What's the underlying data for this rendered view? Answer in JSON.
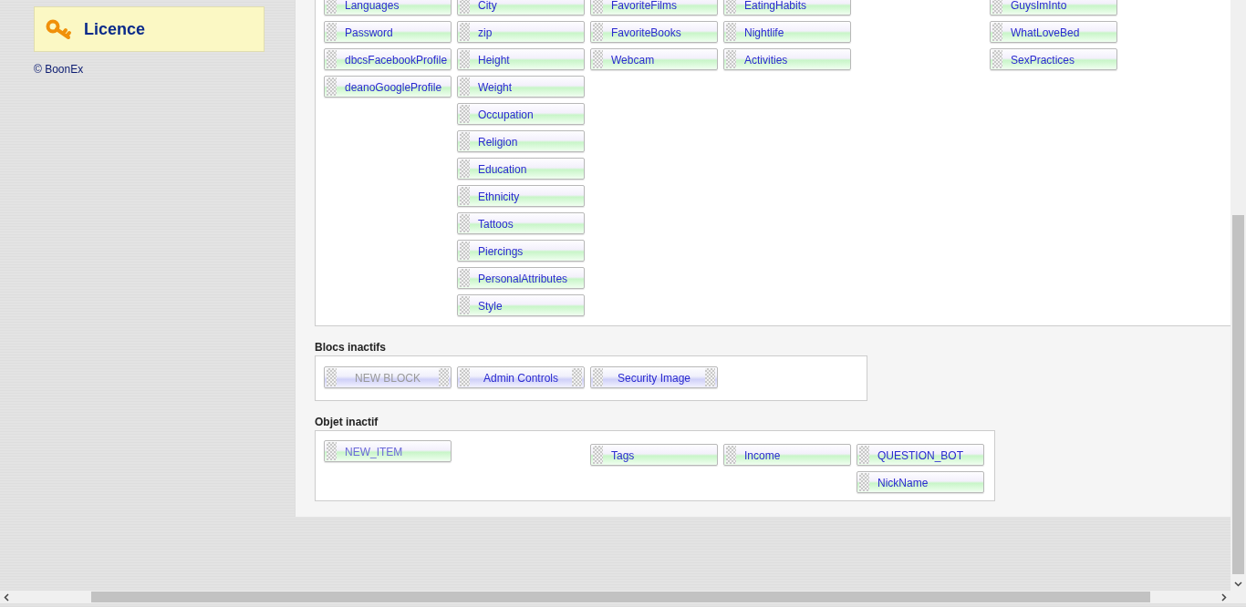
{
  "sidebar": {
    "licence": {
      "label": "Licence"
    },
    "copyright": "© BoonEx"
  },
  "active_fields": {
    "columns": [
      {
        "items": [
          {
            "label": "Languages"
          },
          {
            "label": "Password"
          },
          {
            "label": "dbcsFacebookProfile"
          },
          {
            "label": "deanoGoogleProfile"
          }
        ]
      },
      {
        "items": [
          {
            "label": "City"
          },
          {
            "label": "zip"
          },
          {
            "label": "Height"
          },
          {
            "label": "Weight"
          },
          {
            "label": "Occupation"
          },
          {
            "label": "Religion"
          },
          {
            "label": "Education"
          },
          {
            "label": "Ethnicity"
          },
          {
            "label": "Tattoos"
          },
          {
            "label": "Piercings"
          },
          {
            "label": "PersonalAttributes"
          },
          {
            "label": "Style"
          }
        ]
      },
      {
        "items": [
          {
            "label": "FavoriteFilms"
          },
          {
            "label": "FavoriteBooks"
          },
          {
            "label": "Webcam"
          }
        ]
      },
      {
        "items": [
          {
            "label": "EatingHabits"
          },
          {
            "label": "Nightlife"
          },
          {
            "label": "Activities"
          }
        ]
      },
      {},
      {
        "items": [
          {
            "label": "GuysImInto"
          },
          {
            "label": "WhatLoveBed"
          },
          {
            "label": "SexPractices"
          }
        ]
      }
    ]
  },
  "inactive_blocks": {
    "title": "Blocs inactifs",
    "items": [
      {
        "label": "NEW BLOCK",
        "kind": "new"
      },
      {
        "label": "Admin Controls",
        "kind": "block"
      },
      {
        "label": "Security Image",
        "kind": "block"
      }
    ]
  },
  "inactive_items": {
    "title": "Objet inactif",
    "columns": [
      {
        "items": [
          {
            "label": "NEW_ITEM",
            "kind": "new"
          }
        ]
      },
      {},
      {
        "items": [
          {
            "label": "Tags",
            "kind": "field"
          }
        ]
      },
      {
        "items": [
          {
            "label": "Income",
            "kind": "field"
          }
        ]
      },
      {
        "items": [
          {
            "label": "QUESTION_BOT",
            "kind": "field"
          },
          {
            "label": "NickName",
            "kind": "field"
          }
        ]
      }
    ]
  }
}
